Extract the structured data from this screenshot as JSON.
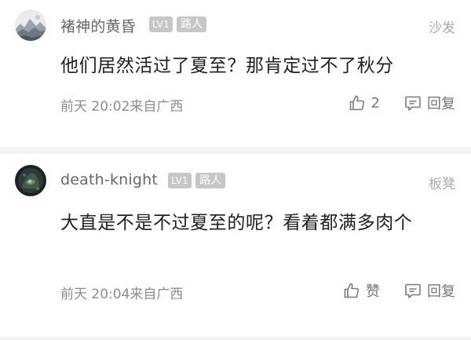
{
  "comments": [
    {
      "username": "褚神的黄昏",
      "level": "LV1",
      "role": "路人",
      "floor": "沙发",
      "content": "他们居然活过了夏至？那肯定过不了秋分",
      "time": "前天 20:02来自广西",
      "like_label": "2",
      "reply_label": "回复"
    },
    {
      "username": "death-knight",
      "level": "LV1",
      "role": "路人",
      "floor": "板凳",
      "content": "大直是不是不过夏至的呢？看着都满多肉个",
      "time": "前天 20:04来自广西",
      "like_label": "赞",
      "reply_label": "回复"
    }
  ],
  "icons": {
    "avatar_1": "landscape-avatar-icon",
    "avatar_2": "dark-character-avatar-icon",
    "like": "thumbs-up-icon",
    "reply": "comment-bubble-icon"
  },
  "colors": {
    "badge_bg": "#c6c6c6",
    "meta_text": "#8c8c8c",
    "separator": "#f4f4f4"
  }
}
